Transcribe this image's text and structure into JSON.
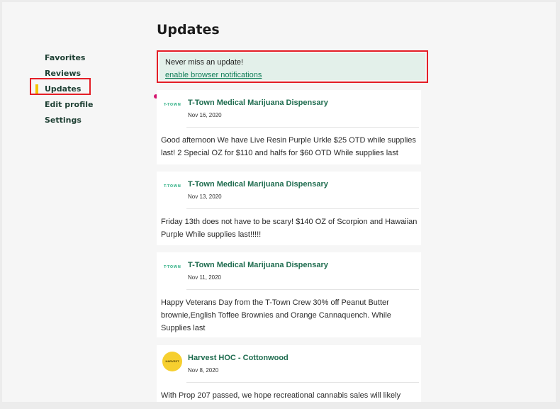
{
  "page": {
    "title": "Updates"
  },
  "sidebar": {
    "items": [
      {
        "label": "Favorites"
      },
      {
        "label": "Reviews"
      },
      {
        "label": "Updates"
      },
      {
        "label": "Edit profile"
      },
      {
        "label": "Settings"
      }
    ]
  },
  "notification": {
    "text": "Never miss an update!",
    "link": "enable browser notifications"
  },
  "updates": [
    {
      "name": "T-Town Medical Marijuana Dispensary",
      "date": "Nov 16, 2020",
      "logo": "T-TOWN",
      "body": "Good afternoon We have Live Resin Purple Urkle $25 OTD while supplies last! 2 Special OZ for $110 and halfs for $60 OTD While supplies last"
    },
    {
      "name": "T-Town Medical Marijuana Dispensary",
      "date": "Nov 13, 2020",
      "logo": "T-TOWN",
      "body": "Friday 13th does not have to be scary! $140 OZ of Scorpion and Hawaiian Purple While supplies last!!!!!"
    },
    {
      "name": "T-Town Medical Marijuana Dispensary",
      "date": "Nov 11, 2020",
      "logo": "T-TOWN",
      "body": "Happy Veterans Day from the T-Town Crew 30% off Peanut Butter brownie,English Toffee Brownies and Orange Cannaquench. While Supplies last"
    },
    {
      "name": "Harvest HOC - Cottonwood",
      "date": "Nov 8, 2020",
      "logo": "HARVEST",
      "body": "With Prop 207 passed, we hope recreational cannabis sales will likely"
    }
  ],
  "colors": {
    "accent_green": "#1f6c4f",
    "active_indicator": "#f3c400",
    "highlight_border": "#e41e26",
    "unread_dot": "#d4146e"
  }
}
